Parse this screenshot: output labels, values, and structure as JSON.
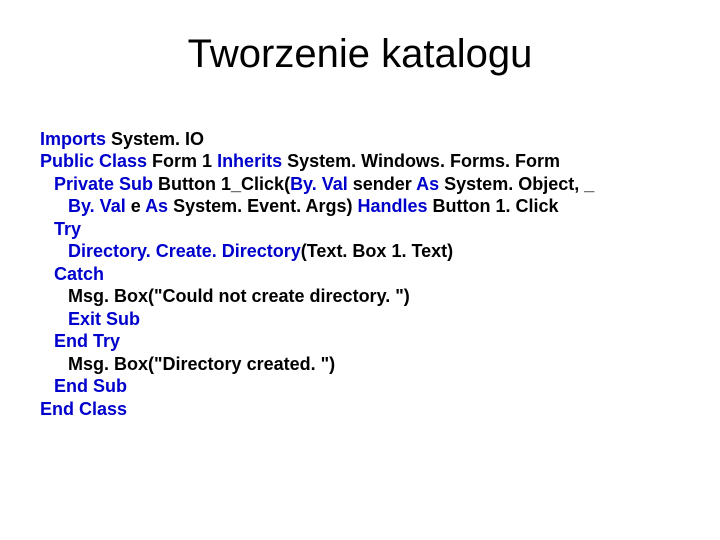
{
  "title": "Tworzenie katalogu",
  "code": {
    "l1a": "Imports",
    "l1b": " System. IO",
    "l2a": "Public Class",
    "l2b": " Form 1 ",
    "l2c": "Inherits",
    "l2d": " System. Windows. Forms. Form",
    "l3a": "Private Sub",
    "l3b": " Button 1_Click(",
    "l3c": "By. Val",
    "l3d": " sender ",
    "l3e": "As",
    "l3f": " System. Object, _",
    "l4a": "By. Val",
    "l4b": " e ",
    "l4c": "As",
    "l4d": " System. Event. Args) ",
    "l4e": "Handles",
    "l4f": " Button 1. Click",
    "l5": "Try",
    "l6a": "Directory. Create. Directory",
    "l6b": "(Text. Box 1. Text)",
    "l7": "Catch",
    "l8": "Msg. Box(\"Could not create directory. \")",
    "l9": "Exit Sub",
    "l10": "End Try",
    "l11": "Msg. Box(\"Directory created. \")",
    "l12": "End Sub",
    "l13": "End Class"
  }
}
